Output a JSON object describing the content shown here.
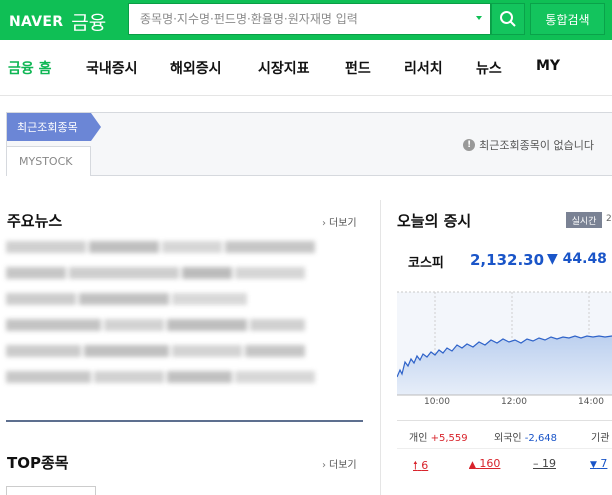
{
  "header": {
    "logo_naver": "NAVER",
    "logo_finance": "금융",
    "search_placeholder": "종목명·지수명·펀드명·환율명·원자재명 입력",
    "search_button_icon": "search-icon",
    "total_search_label": "통합검색",
    "accent": "#0fbf55"
  },
  "nav": {
    "items": [
      {
        "label": "금융 홈",
        "active": true
      },
      {
        "label": "국내증시"
      },
      {
        "label": "해외증시"
      },
      {
        "label": "시장지표"
      },
      {
        "label": "펀드"
      },
      {
        "label": "리서치"
      },
      {
        "label": "뉴스"
      },
      {
        "label": "MY"
      }
    ]
  },
  "recent": {
    "tag": "최근조회종목",
    "mystock": "MYSTOCK",
    "empty_message": "최근조회종목이 없습니다"
  },
  "news": {
    "title": "주요뉴스",
    "more": "더보기"
  },
  "top": {
    "title": "TOP종목",
    "more": "더보기"
  },
  "market": {
    "title": "오늘의 증시",
    "realtime_badge": "실시간",
    "realtime_suffix": "2",
    "index_name": "코스피",
    "index_value": "2,132.30",
    "index_change": "▼ 44.48",
    "up_color": "#d8242c",
    "down_color": "#1a55c8",
    "chart_ticks": [
      "10:00",
      "12:00",
      "14:00"
    ],
    "investors": [
      {
        "label": "개인",
        "value": "+5,559",
        "dir": "up"
      },
      {
        "label": "외국인",
        "value": "-2,648",
        "dir": "dn"
      },
      {
        "label": "기관",
        "value": "",
        "dir": "none"
      }
    ],
    "sectors": [
      {
        "value": "6",
        "dir": "up",
        "icon": "arrow-up-icon"
      },
      {
        "value": "160",
        "dir": "up",
        "icon": "triangle-up-icon"
      },
      {
        "value": "19",
        "dir": "flat",
        "icon": "dash-icon"
      },
      {
        "value": "7",
        "dir": "dn",
        "icon": "triangle-down-icon"
      }
    ]
  }
}
